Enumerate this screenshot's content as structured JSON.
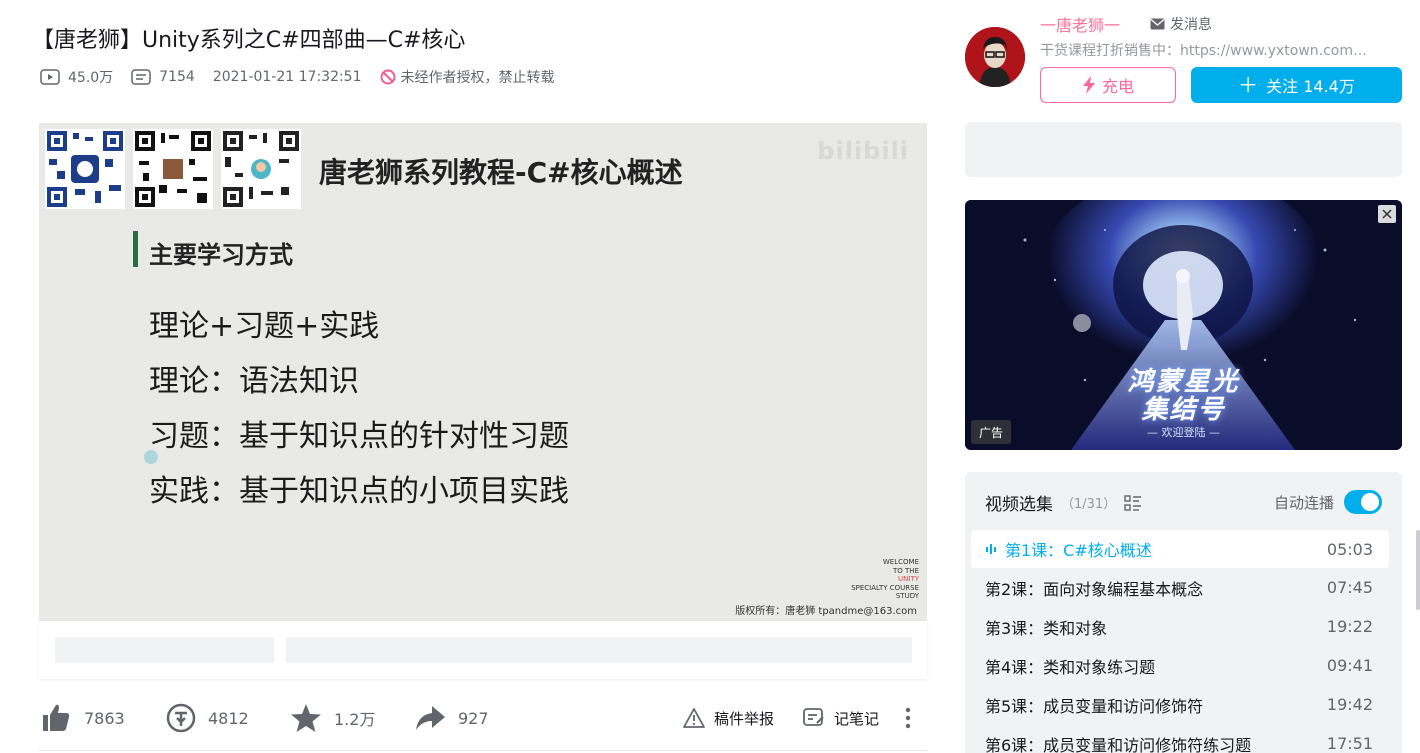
{
  "video": {
    "title": "【唐老狮】Unity系列之C#四部曲—C#核心",
    "plays": "45.0万",
    "danmaku": "7154",
    "date": "2021-01-21 17:32:51",
    "notice": "未经作者授权，禁止转载"
  },
  "slide": {
    "title": "唐老狮系列教程-C#核心概述",
    "watermark": "bilibili",
    "section": "主要学习方式",
    "lines": [
      "理论+习题+实践",
      "理论：语法知识",
      "习题：基于知识点的针对性习题",
      "实践：基于知识点的小项目实践"
    ],
    "welcome": [
      "WELCOME",
      "TO THE",
      "UNITY",
      "SPECIALTY COURSE",
      "STUDY"
    ],
    "copyright": "版权所有：唐老狮 tpandme@163.com"
  },
  "actions": {
    "like": "7863",
    "coin": "4812",
    "favorite": "1.2万",
    "share": "927",
    "report": "稿件举报",
    "note": "记笔记"
  },
  "uploader": {
    "name": "一唐老狮一",
    "message": "发消息",
    "desc": "干货课程打折销售中：https://www.yxtown.com…",
    "charge": "充电",
    "follow": "关注 14.4万"
  },
  "ad": {
    "title_line1": "鸿蒙星光",
    "title_line2": "集结号",
    "subtitle": "— 欢迎登陆 —",
    "badge": "广告"
  },
  "playlist": {
    "title": "视频选集",
    "count": "（1/31）",
    "autoplay": "自动连播",
    "items": [
      {
        "title": "第1课：C#核心概述",
        "duration": "05:03"
      },
      {
        "title": "第2课：面向对象编程基本概念",
        "duration": "07:45"
      },
      {
        "title": "第3课：类和对象",
        "duration": "19:22"
      },
      {
        "title": "第4课：类和对象练习题",
        "duration": "09:41"
      },
      {
        "title": "第5课：成员变量和访问修饰符",
        "duration": "19:42"
      },
      {
        "title": "第6课：成员变量和访问修饰符练习题",
        "duration": "17:51"
      }
    ]
  },
  "colors": {
    "accent": "#00aeec",
    "pink": "#fb7299",
    "slide_bg": "#e9e9e7",
    "section_bar": "#2e6b3f"
  }
}
